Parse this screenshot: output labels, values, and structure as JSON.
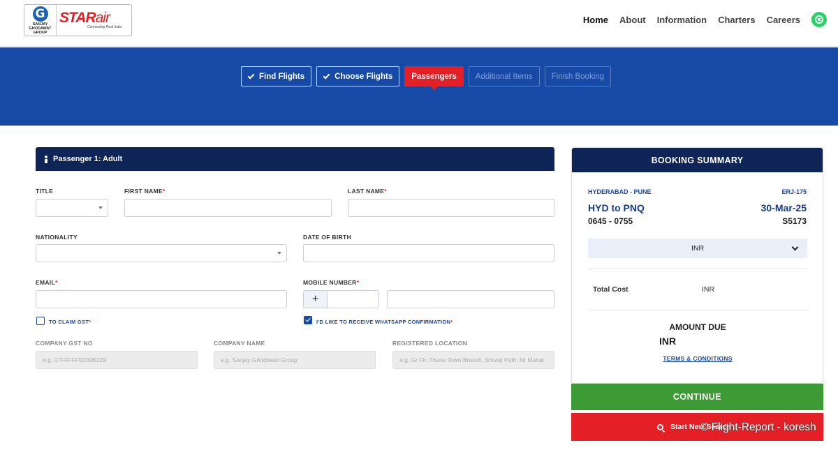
{
  "logo": {
    "group_letter": "G",
    "group_text": "SANJAY\nGHODAWAT\nGROUP",
    "brand_star": "STAR",
    "brand_air": "air",
    "tagline": "Connecting Real India"
  },
  "nav": {
    "items": [
      "Home",
      "About",
      "Information",
      "Charters",
      "Careers"
    ],
    "whatsapp_icon": "whatsapp-icon"
  },
  "steps": [
    {
      "label": "Find Flights",
      "state": "done"
    },
    {
      "label": "Choose Flights",
      "state": "done"
    },
    {
      "label": "Passengers",
      "state": "current"
    },
    {
      "label": "Additional Items",
      "state": "future"
    },
    {
      "label": "Finish Booking",
      "state": "future"
    }
  ],
  "passenger": {
    "header": "Passenger 1: Adult",
    "title_label": "TITLE",
    "first_name_label": "FIRST NAME",
    "last_name_label": "LAST NAME",
    "nationality_label": "NATIONALITY",
    "dob_label": "DATE OF BIRTH",
    "email_label": "EMAIL",
    "mobile_label": "MOBILE NUMBER",
    "mobile_prefix": "+",
    "required_mark": "*",
    "gst_checkbox_label": "TO CLAIM GST",
    "whatsapp_checkbox_label": "I'D LIKE TO RECEIVE WHATSAPP CONFIRMATION",
    "company_gst_label": "COMPANY GST NO",
    "company_gst_placeholder": "e.g. 07FFFFF0000B2Z9",
    "company_name_label": "COMPANY NAME",
    "company_name_placeholder": "e.g. Sanjay Ghodawat Group",
    "registered_location_label": "REGISTERED LOCATION",
    "registered_location_placeholder": "e.g. Gr Flr, Thane Town Branch, Shivaji Path, Nr Mahat"
  },
  "summary": {
    "header": "BOOKING SUMMARY",
    "route_name": "HYDERABAD - PUNE",
    "aircraft": "ERJ-175",
    "route_code": "HYD to PNQ",
    "date": "30-Mar-25",
    "times": "0645 - 0755",
    "flight_no": "S5173",
    "currency": "INR",
    "total_cost_label": "Total Cost",
    "total_cost_value": "INR",
    "amount_due_label": "AMOUNT DUE",
    "amount_due_value": "INR",
    "terms_label": "TERMS & CONDITIONS"
  },
  "buttons": {
    "continue": "CONTINUE",
    "new_search": "Start New Search"
  },
  "watermark": "© Flight-Report - koresh"
}
